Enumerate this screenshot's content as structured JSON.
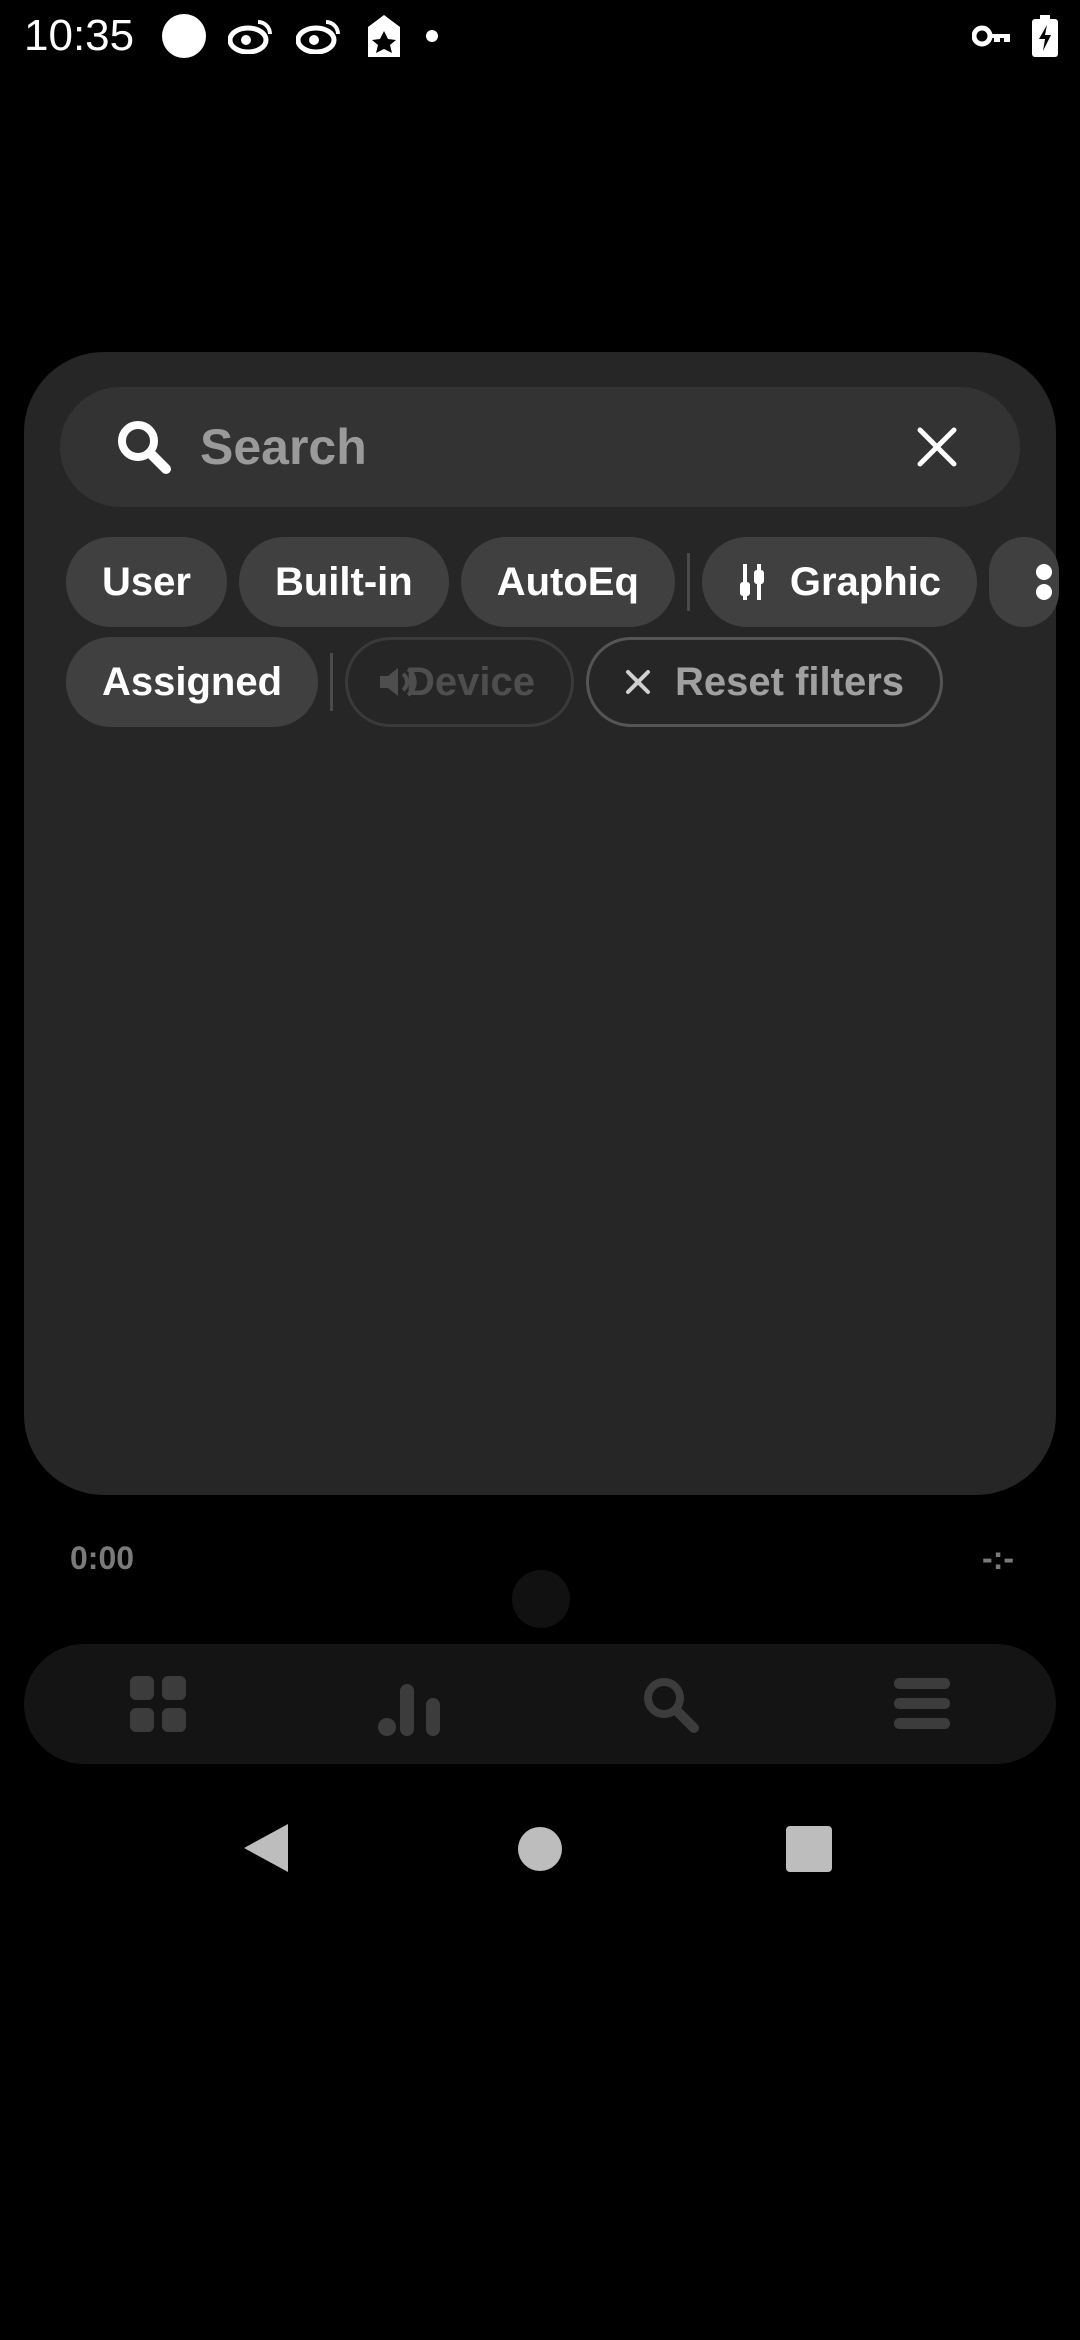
{
  "status_bar": {
    "time": "10:35",
    "icons_left": [
      "circle-icon",
      "weibo-icon",
      "weibo-icon",
      "tag-star-icon",
      "dot-icon"
    ],
    "icons_right": [
      "vpn-key-icon",
      "battery-charging-icon"
    ]
  },
  "search": {
    "placeholder": "Search",
    "value": ""
  },
  "filters": {
    "row1": [
      {
        "label": "User"
      },
      {
        "label": "Built-in"
      },
      {
        "label": "AutoEq"
      },
      {
        "label": "Graphic",
        "icon": "sliders-icon"
      }
    ],
    "row2": [
      {
        "label": "Assigned"
      },
      {
        "label": "Device",
        "icon": "speaker-icon",
        "state": "disabled"
      },
      {
        "label": "Reset filters",
        "icon": "close-icon"
      }
    ]
  },
  "player": {
    "elapsed": "0:00",
    "remaining": "-:-"
  },
  "bottom_nav": {
    "items": [
      "grid-icon",
      "bar-chart-icon",
      "search-icon",
      "menu-icon"
    ]
  },
  "colors": {
    "panel": "#262626",
    "chip": "#404040",
    "search_bg": "#333333",
    "nav_bg": "#141414",
    "muted_text": "#7a7a7a"
  }
}
